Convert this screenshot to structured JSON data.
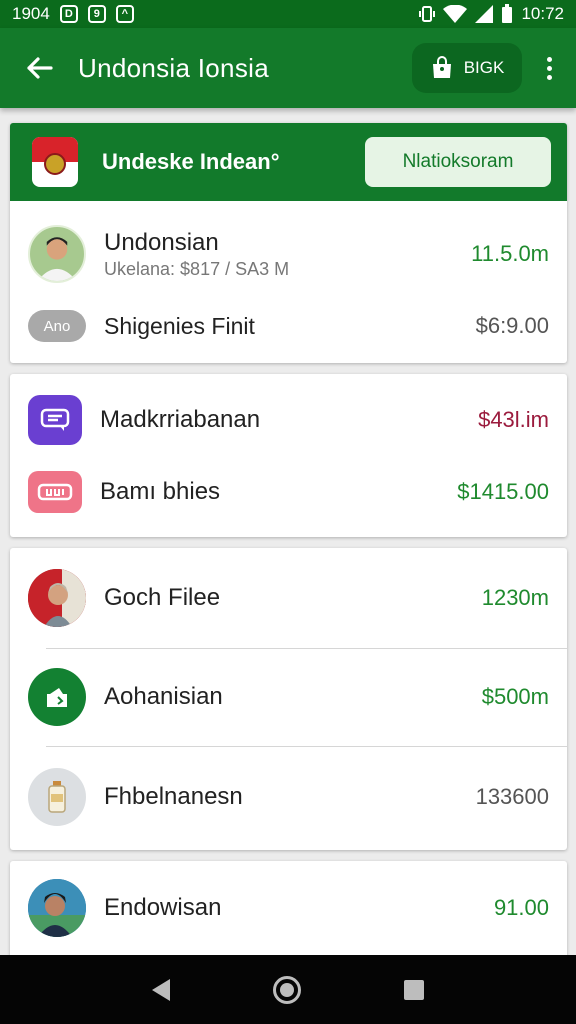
{
  "status_bar": {
    "left_time": "1904",
    "right_time": "10:72"
  },
  "app_bar": {
    "title": "Undonsia Ionsia",
    "action_label": "BIGK"
  },
  "header_card": {
    "title": "Undeske Indean°",
    "button_label": "Nlatioksoram"
  },
  "card1": {
    "person": {
      "name": "Undonsian",
      "subtitle": "Ukelana: $817 / SA3 M",
      "amount": "11.5.0m"
    },
    "item": {
      "badge": "Ano",
      "label": "Shigenies Finit",
      "amount": "$6:9.00"
    }
  },
  "card2": {
    "items": [
      {
        "label": "Madkrriabanan",
        "amount": "$43l.im"
      },
      {
        "label": "Bamı bhies",
        "amount": "$1415.00"
      }
    ]
  },
  "card3": {
    "items": [
      {
        "label": "Goch Filee",
        "amount": "1230m"
      },
      {
        "label": "Aohanisian",
        "amount": "$500m"
      },
      {
        "label": "Fhbelnanesn",
        "amount": "133600"
      }
    ]
  },
  "card4": {
    "item": {
      "label": "Endowisan",
      "amount": "91.00"
    }
  },
  "colors": {
    "primary": "#137a2a",
    "dark_primary": "#0b6b1c",
    "positive": "#1f8a2e",
    "negative": "#9b1b3d"
  },
  "icons": [
    "back-arrow-icon",
    "shopping-bag-icon",
    "more-vert-icon",
    "flag-icon",
    "chat-icon",
    "ticket-icon",
    "wallet-icon",
    "bottle-icon",
    "nav-back-icon",
    "nav-home-icon",
    "nav-recent-icon"
  ]
}
